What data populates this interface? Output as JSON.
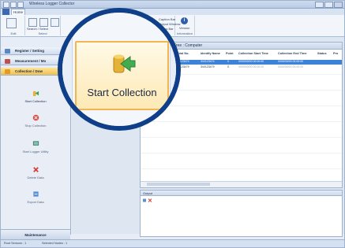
{
  "window": {
    "title": "Wireless Logger Collector"
  },
  "tabs": {
    "home": "Home"
  },
  "ribbon": {
    "edit_group": "Edit",
    "select_group": "Select",
    "view_group": "View",
    "info_group": "Information",
    "btn_search": "Search / Select",
    "btn_select_all": "Select All",
    "caption_bar": "Caption Bar",
    "output_window": "Output Window",
    "status_bar": "Status Bar",
    "version": "Version"
  },
  "nav": {
    "register": "Register / Setting",
    "measurement": "Measurement / Mo",
    "collection": "Collection / Dow",
    "items": [
      {
        "label": "Start Collection"
      },
      {
        "label": "Stop Collection"
      },
      {
        "label": "Start Logger Utility"
      },
      {
        "label": "Delete Data"
      },
      {
        "label": "Export Data"
      }
    ],
    "maintenance": "Maintenance"
  },
  "panel": {
    "title": "Tree : Computer"
  },
  "table": {
    "headers": [
      "Serial No.",
      "Identify Name",
      "Point",
      "Collection Start Time",
      "Collection End Time",
      "Status",
      "Pro"
    ],
    "rows": [
      [
        "3/4/123474",
        "3/4/123474",
        "0",
        "0000/00/00 00:00:00",
        "0000/00/00 00:00:00",
        "",
        ""
      ],
      [
        "3/4/123479",
        "3/4/123479",
        "0",
        "0000/00/00 00:00:00",
        "0000/00/00 00:00:00",
        "",
        ""
      ]
    ]
  },
  "output": {
    "title": "Output"
  },
  "status": {
    "left": "Root Sensors : 1",
    "mid": "Selected Nodes : 1"
  },
  "magnifier": {
    "label": "Start Collection"
  },
  "colors": {
    "accent": "#0e3f88",
    "selection": "#3c82d8",
    "active_nav": "#f2c04c"
  }
}
